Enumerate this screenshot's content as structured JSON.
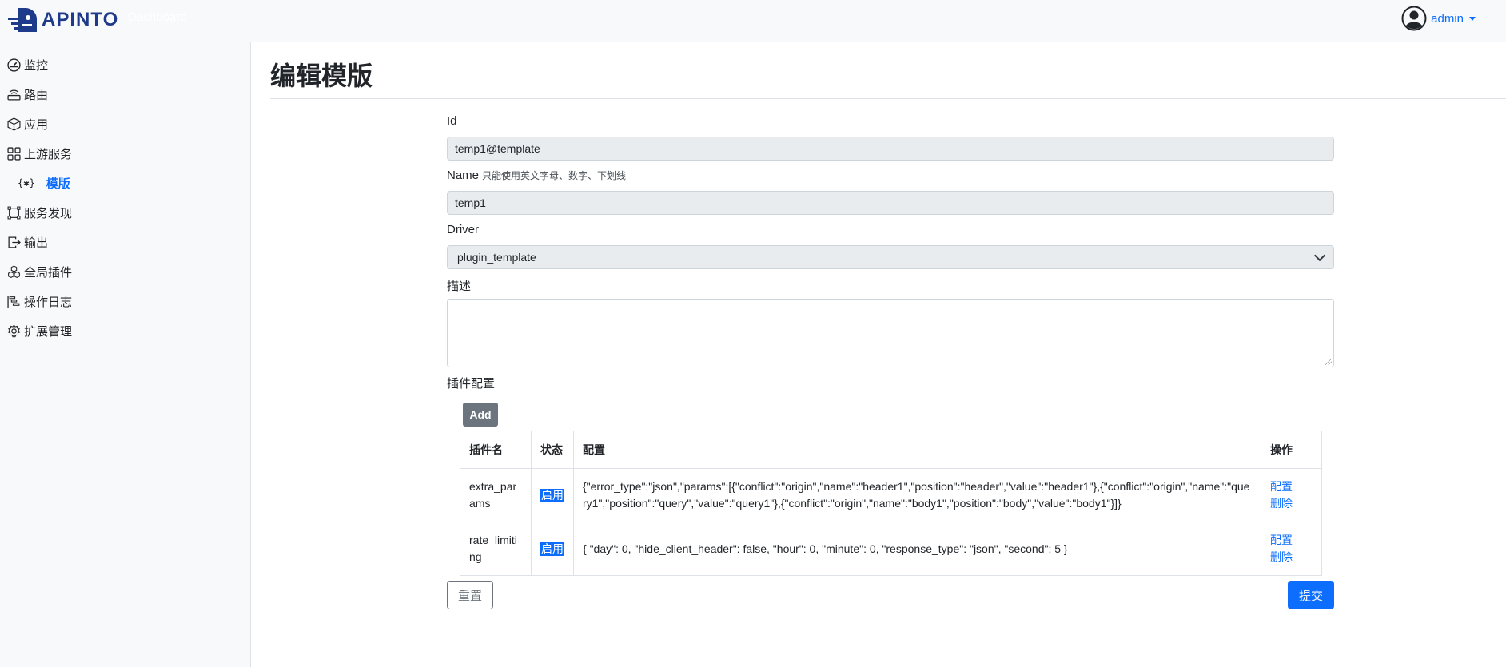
{
  "brand": {
    "name": "APINTO",
    "subtitle": "Dashboard"
  },
  "user": {
    "name": "admin"
  },
  "sidebar": {
    "items": [
      {
        "label": "监控",
        "icon": "speedometer-icon"
      },
      {
        "label": "路由",
        "icon": "router-icon"
      },
      {
        "label": "应用",
        "icon": "box-icon"
      },
      {
        "label": "上游服务",
        "icon": "grid-icon"
      },
      {
        "label": "模版",
        "icon": "curly-braces-icon",
        "active": true
      },
      {
        "label": "服务发现",
        "icon": "bounding-box-icon"
      },
      {
        "label": "输出",
        "icon": "box-arrow-right-icon"
      },
      {
        "label": "全局插件",
        "icon": "boxes-icon"
      },
      {
        "label": "操作日志",
        "icon": "bar-chart-steps-icon"
      },
      {
        "label": "扩展管理",
        "icon": "gear-icon"
      }
    ],
    "template_glyph": "{✱}"
  },
  "page": {
    "title": "编辑模版"
  },
  "form": {
    "id_label": "Id",
    "id_value": "temp1@template",
    "name_label": "Name",
    "name_hint": "只能使用英文字母、数字、下划线",
    "name_value": "temp1",
    "driver_label": "Driver",
    "driver_value": "plugin_template",
    "desc_label": "描述",
    "desc_value": "",
    "plugins_label": "插件配置",
    "add_label": "Add",
    "reset_label": "重置",
    "submit_label": "提交"
  },
  "plugins": {
    "headers": {
      "name": "插件名",
      "status": "状态",
      "config": "配置",
      "actions": "操作"
    },
    "rows": [
      {
        "name": "extra_params",
        "status": "启用",
        "config": "{\"error_type\":\"json\",\"params\":[{\"conflict\":\"origin\",\"name\":\"header1\",\"position\":\"header\",\"value\":\"header1\"},{\"conflict\":\"origin\",\"name\":\"query1\",\"position\":\"query\",\"value\":\"query1\"},{\"conflict\":\"origin\",\"name\":\"body1\",\"position\":\"body\",\"value\":\"body1\"}]}",
        "config_action": "配置",
        "delete_action": "删除"
      },
      {
        "name": "rate_limiting",
        "status": "启用",
        "config": "{ \"day\": 0, \"hide_client_header\": false, \"hour\": 0, \"minute\": 0, \"response_type\": \"json\", \"second\": 5 }",
        "config_action": "配置",
        "delete_action": "删除"
      }
    ]
  },
  "colors": {
    "primary": "#0d6efd",
    "secondary": "#6c757d",
    "brand": "#1e3a8a",
    "sidebar_bg": "#f8f9fa"
  }
}
